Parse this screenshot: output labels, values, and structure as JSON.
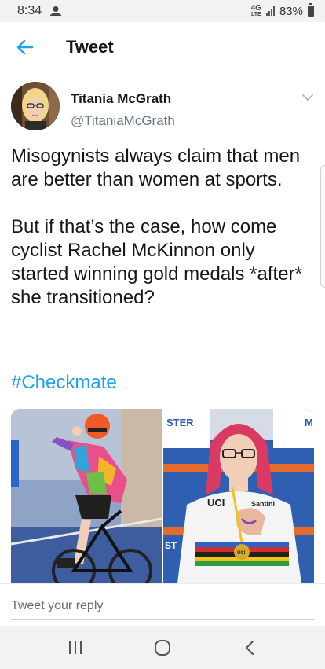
{
  "status_bar": {
    "time": "8:34",
    "network": "4G",
    "network_sub": "LTE",
    "battery": "83%"
  },
  "header": {
    "title": "Tweet",
    "back_icon": "arrow-left-icon",
    "accent": "#1da1f2"
  },
  "tweet": {
    "author_name": "Titania McGrath",
    "author_handle": "@TitaniaMcGrath",
    "text": "Misogynists always claim that men are better than women at sports.\n\nBut if that’s the case, how come cyclist Rachel McKinnon only started winning gold medals *after* she transitioned?",
    "hashtag": "#Checkmate",
    "media": [
      {
        "name": "cyclist-racing-photo"
      },
      {
        "name": "cyclist-medal-photo"
      }
    ],
    "media_text": {
      "banner_left": "STER",
      "banner_right": "M",
      "jersey_left": "UCI",
      "jersey_right": "Santini",
      "medal": "UCI",
      "side": "ST"
    }
  },
  "reply": {
    "placeholder": "Tweet your reply"
  },
  "nav": {
    "recent_icon": "recent-apps-icon",
    "home_icon": "home-icon",
    "back_icon": "back-icon"
  }
}
